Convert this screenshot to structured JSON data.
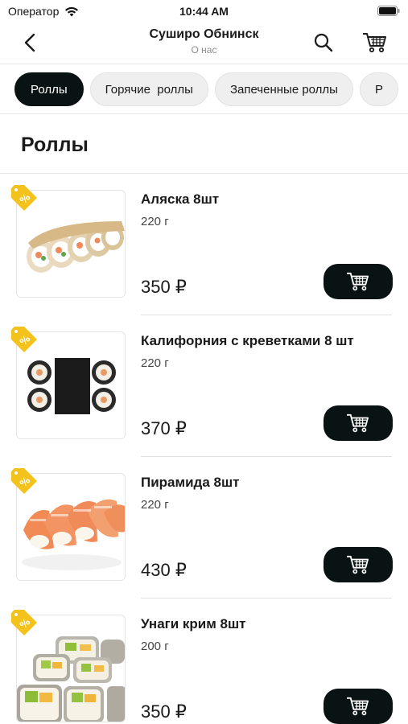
{
  "status_bar": {
    "carrier": "Оператор",
    "time": "10:44 AM"
  },
  "header": {
    "title": "Суширо Обнинск",
    "subtitle": "О нас"
  },
  "categories": [
    {
      "label": "Роллы",
      "active": true
    },
    {
      "label": "Горячие  роллы",
      "active": false
    },
    {
      "label": "Запеченные роллы",
      "active": false
    },
    {
      "label": "Р",
      "active": false
    }
  ],
  "section": {
    "title": "Роллы"
  },
  "products": [
    {
      "name": "Аляска 8шт",
      "weight": "220 г",
      "price": "350 ₽",
      "badge": "%"
    },
    {
      "name": "Калифорния с креветками 8 шт",
      "weight": "220 г",
      "price": "370 ₽",
      "badge": "%"
    },
    {
      "name": "Пирамида 8шт",
      "weight": "220 г",
      "price": "430 ₽",
      "badge": "%"
    },
    {
      "name": "Унаги крим 8шт",
      "weight": "200 г",
      "price": "350 ₽",
      "badge": "%"
    }
  ],
  "colors": {
    "accent_dark": "#0a1313",
    "badge": "#f4c21d",
    "chip_bg": "#efefef"
  },
  "icons": {
    "back": "chevron-left-icon",
    "search": "search-icon",
    "cart": "cart-icon",
    "badge": "discount-tag-icon",
    "wifi": "wifi-icon",
    "battery": "battery-icon"
  }
}
